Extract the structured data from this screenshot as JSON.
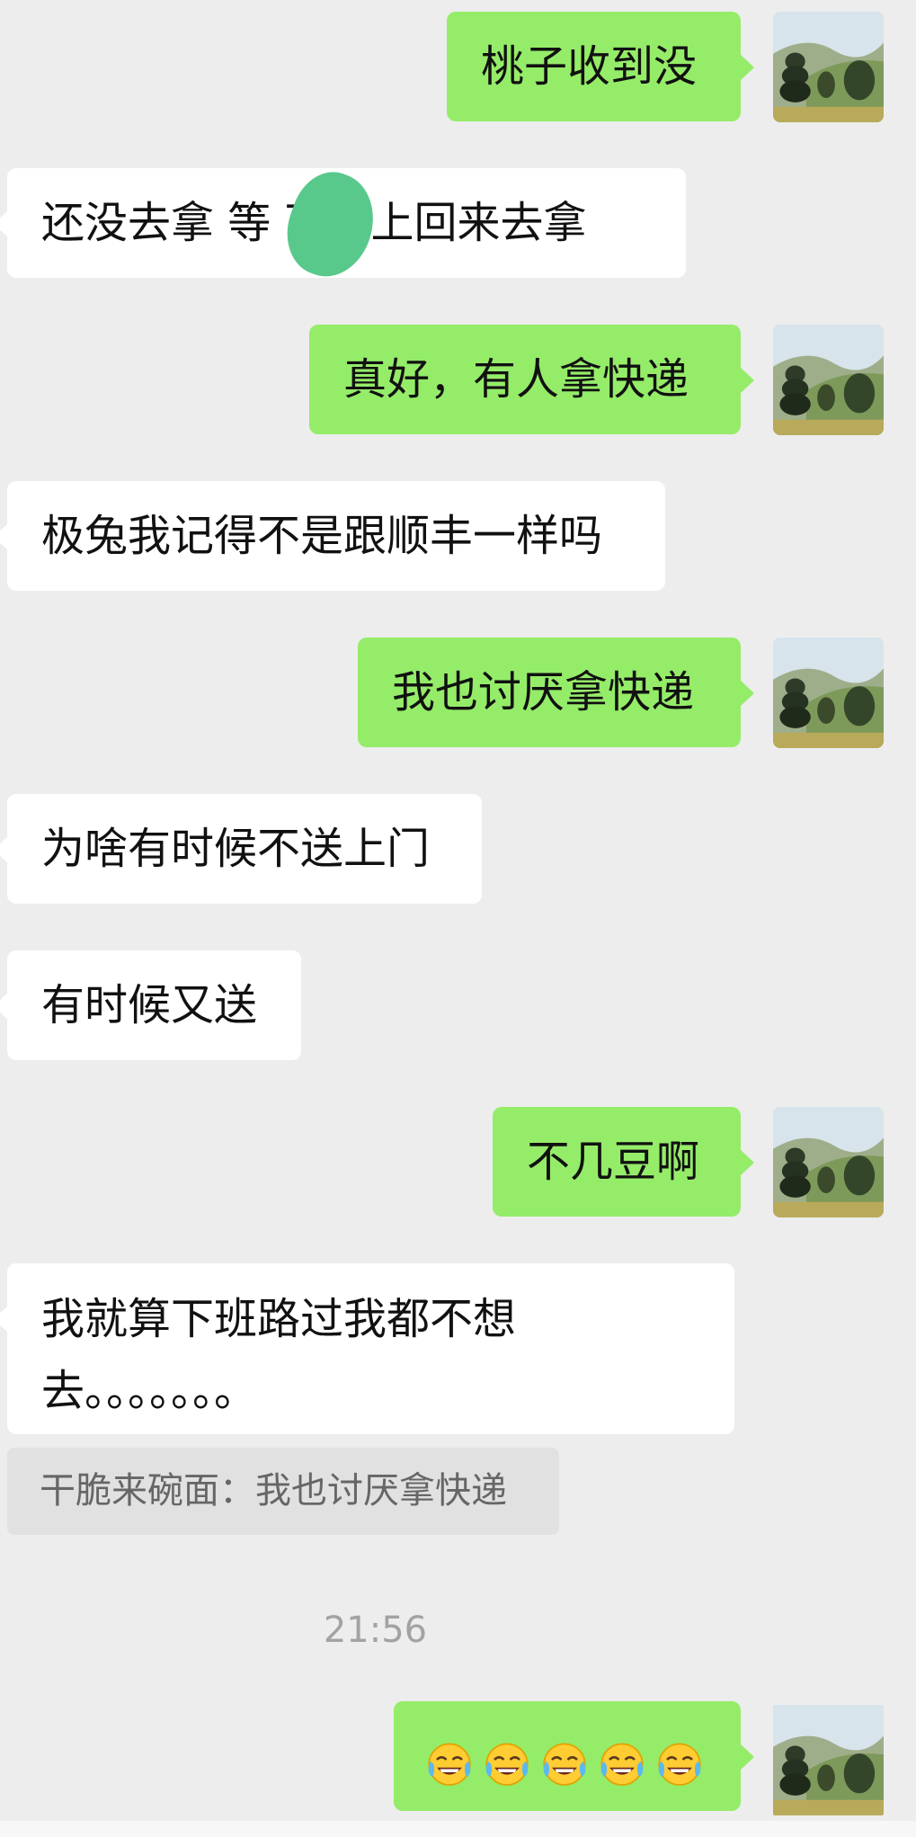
{
  "messages": [
    {
      "id": "m1",
      "side": "out",
      "text": "桃子收到没"
    },
    {
      "id": "m2",
      "side": "in",
      "text": "还没去拿  等    下晚上回来去拿"
    },
    {
      "id": "m3",
      "side": "out",
      "text": "真好，有人拿快递"
    },
    {
      "id": "m4",
      "side": "in",
      "text": "极兔我记得不是跟顺丰一样吗"
    },
    {
      "id": "m5",
      "side": "out",
      "text": "我也讨厌拿快递"
    },
    {
      "id": "m6",
      "side": "in",
      "text": "为啥有时候不送上门"
    },
    {
      "id": "m7",
      "side": "in",
      "text": "有时候又送"
    },
    {
      "id": "m8",
      "side": "out",
      "text": "不几豆啊"
    },
    {
      "id": "m9",
      "side": "in",
      "text": "我就算下班路过我都不想去。。。。。。。"
    },
    {
      "id": "m10",
      "side": "out",
      "emoji": "face-with-tears-of-joy",
      "emoji_count": 5
    }
  ],
  "quote": {
    "text": "干脆来碗面：我也讨厌拿快递"
  },
  "timestamp": "21:56",
  "colors": {
    "background": "#ededed",
    "outgoing_bubble": "#95ec69",
    "incoming_bubble": "#ffffff",
    "quote_bg": "#e1e1e1",
    "timestamp": "#a2a2a2"
  }
}
